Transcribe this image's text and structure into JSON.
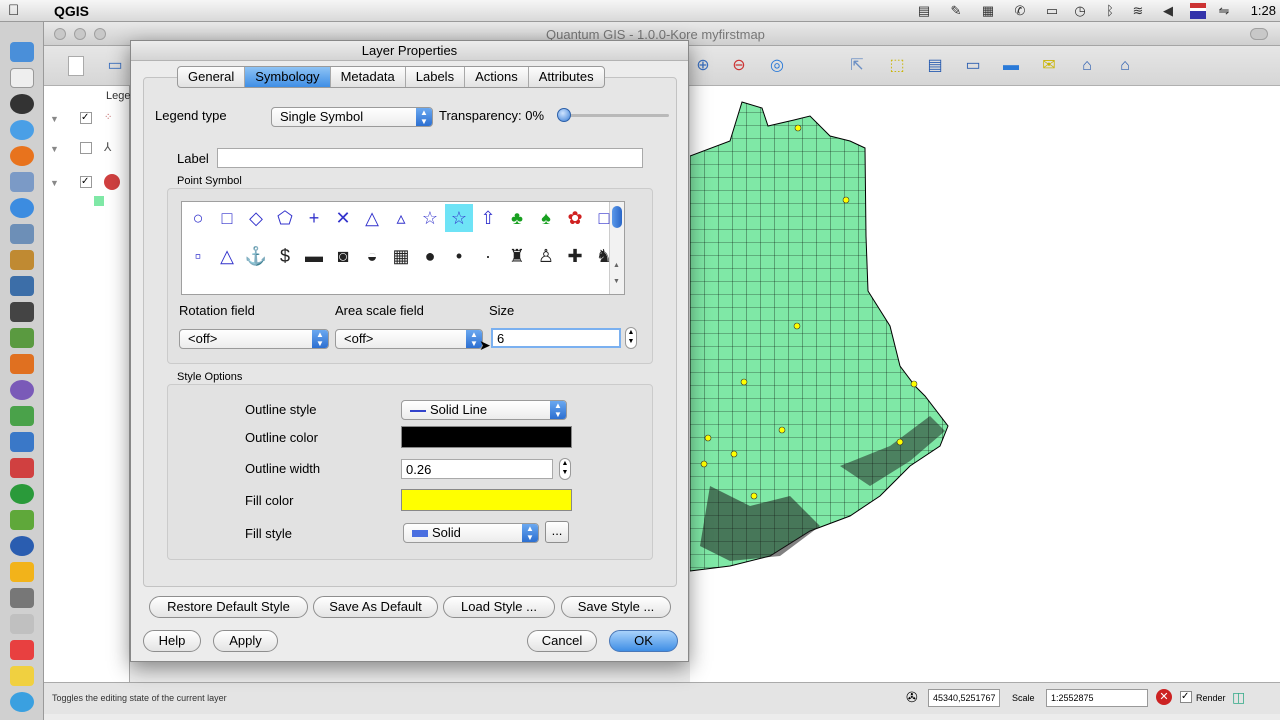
{
  "menubar": {
    "app_name": "QGIS",
    "clock": "1:28"
  },
  "window": {
    "title": "Quantum GIS - 1.0.0-Kore  myfirstmap",
    "legend_header": "Lege"
  },
  "dialog": {
    "title": "Layer Properties",
    "tabs": [
      "General",
      "Symbology",
      "Metadata",
      "Labels",
      "Actions",
      "Attributes"
    ],
    "active_tab": "Symbology",
    "legend_type_label": "Legend type",
    "legend_type_value": "Single Symbol",
    "transparency_label": "Transparency: 0%",
    "transparency_value_pct": 0,
    "label_label": "Label",
    "label_value": "",
    "point_symbol_title": "Point Symbol",
    "rotation_field_label": "Rotation field",
    "rotation_field_value": "<off>",
    "area_scale_label": "Area scale field",
    "area_scale_value": "<off>",
    "size_label": "Size",
    "size_value": "6",
    "style_options_title": "Style Options",
    "outline_style_label": "Outline style",
    "outline_style_value": "Solid Line",
    "outline_color_label": "Outline color",
    "outline_color": "#000000",
    "outline_width_label": "Outline width",
    "outline_width_value": "0.26",
    "fill_color_label": "Fill color",
    "fill_color": "#ffff00",
    "fill_style_label": "Fill style",
    "fill_style_value": "Solid",
    "more_label": "...",
    "buttons": {
      "restore_default": "Restore Default Style",
      "save_as_default": "Save As Default",
      "load_style": "Load Style ...",
      "save_style": "Save Style ...",
      "help": "Help",
      "apply": "Apply",
      "cancel": "Cancel",
      "ok": "OK"
    }
  },
  "statusbar": {
    "message": "Toggles the editing state of the current layer",
    "coordinates": "45340,5251767",
    "scale_label": "Scale",
    "scale_value": "1:2552875",
    "render_label": "Render"
  },
  "colors": {
    "map_fill": "#7fe8a6",
    "accent": "#3f8ee5",
    "selected_symbol": "#6ee3f6"
  },
  "symbols_row1": [
    "circle-icon",
    "square-icon",
    "diamond-icon",
    "pentagon-icon",
    "cross-icon",
    "x-icon",
    "triangle-icon",
    "triangle-small-icon",
    "star-icon",
    "star-selected-icon",
    "arrow-up-icon",
    "tree-icon",
    "tree-round-icon",
    "flower-icon",
    "empty-square-icon"
  ],
  "symbols_row2": [
    "square-small-icon",
    "triangle-outline-icon",
    "anchor-icon",
    "dollar-icon",
    "pipe-icon",
    "camera-icon",
    "car-icon",
    "building-icon",
    "dot-large-icon",
    "dot-medium-icon",
    "dot-small-icon",
    "pump-icon",
    "people-icon",
    "hospital-icon",
    "deer-icon"
  ]
}
